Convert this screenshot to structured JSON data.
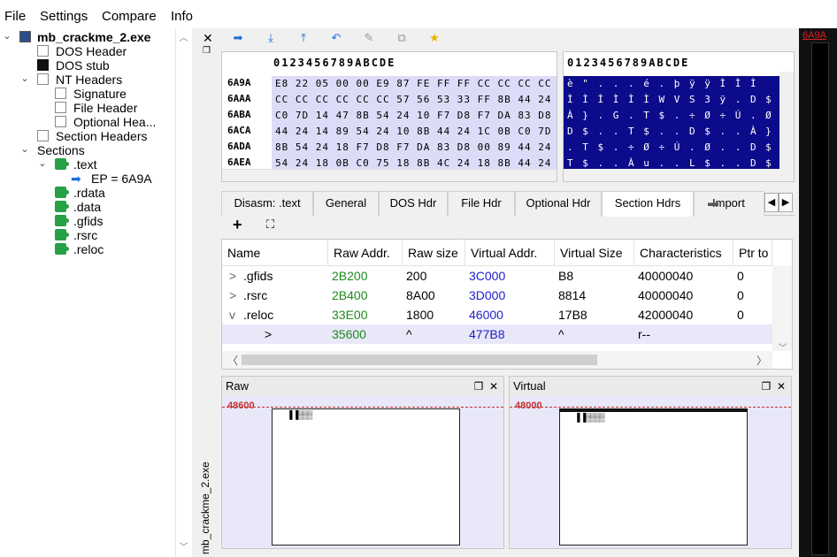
{
  "menu": [
    "File",
    "Settings",
    "Compare",
    "Info"
  ],
  "tree": {
    "root": "mb_crackme_2.exe",
    "dos_header": "DOS Header",
    "dos_stub": "DOS stub",
    "nt_headers": "NT Headers",
    "signature": "Signature",
    "file_header": "File Header",
    "optional_header": "Optional Hea...",
    "section_headers": "Section Headers",
    "sections": "Sections",
    "text": ".text",
    "ep": "EP = 6A9A",
    "rdata": ".rdata",
    "data": ".data",
    "gfids": ".gfids",
    "rsrc": ".rsrc",
    "reloc": ".reloc"
  },
  "side_strip": {
    "label": "mb_crackme_2.exe"
  },
  "hex": {
    "columns": "0123456789ABCDE",
    "rows": [
      {
        "addr": "6A9A",
        "bytes": "E8 22 05 00 00 E9 87 FE FF FF CC CC CC CC CC"
      },
      {
        "addr": "6AAA",
        "bytes": "CC CC CC CC CC CC 57 56 53 33 FF 8B 44 24 14"
      },
      {
        "addr": "6ABA",
        "bytes": "C0 7D 14 47 8B 54 24 10 F7 D8 F7 DA 83 D8 00"
      },
      {
        "addr": "6ACA",
        "bytes": "44 24 14 89 54 24 10 8B 44 24 1C 0B C0 7D 14"
      },
      {
        "addr": "6ADA",
        "bytes": "8B 54 24 18 F7 D8 F7 DA 83 D8 00 89 44 24 10"
      },
      {
        "addr": "6AEA",
        "bytes": "54 24 18 0B C0 75 18 8B 4C 24 18 8B 44 24 10"
      }
    ]
  },
  "text_view": {
    "columns": "0123456789ABCDE",
    "rows": [
      "è \" . . . é . þ ÿ ÿ Ì Ì Ì",
      "Ì Ì Ì Ì Ì Ì W V S 3 ÿ . D $",
      "À } . G . T $ . ÷ Ø ÷ Ú . Ø",
      "D $ . . T $ . . D $ . . À }",
      ". T $ . ÷ Ø ÷ Ú . Ø . . D $",
      "T $ . . À u . . L $ . . D $"
    ]
  },
  "tabs": [
    "Disasm: .text",
    "General",
    "DOS Hdr",
    "File Hdr",
    "Optional Hdr",
    "Section Hdrs",
    "Import"
  ],
  "active_tab": "Section Hdrs",
  "table": {
    "headers": [
      "Name",
      "Raw Addr.",
      "Raw size",
      "Virtual Addr.",
      "Virtual Size",
      "Characteristics",
      "Ptr to"
    ],
    "rows": [
      {
        "exp": ">",
        "name": ".gfids",
        "raw_addr": "2B200",
        "raw_size": "200",
        "virt_addr": "3C000",
        "virt_size": "B8",
        "chars": "40000040",
        "ptr": "0"
      },
      {
        "exp": ">",
        "name": ".rsrc",
        "raw_addr": "2B400",
        "raw_size": "8A00",
        "virt_addr": "3D000",
        "virt_size": "8814",
        "chars": "40000040",
        "ptr": "0"
      },
      {
        "exp": "v",
        "name": ".reloc",
        "raw_addr": "33E00",
        "raw_size": "1800",
        "virt_addr": "46000",
        "virt_size": "17B8",
        "chars": "42000040",
        "ptr": "0"
      },
      {
        "exp": "",
        "name": ">",
        "raw_addr": "35600",
        "raw_size": "^",
        "virt_addr": "477B8",
        "virt_size": "^",
        "chars": "r--",
        "ptr": ""
      }
    ]
  },
  "raw_pane": {
    "title": "Raw",
    "marker": "48600"
  },
  "virtual_pane": {
    "title": "Virtual",
    "marker": "48000"
  },
  "rail": {
    "value": "6A9A"
  },
  "colors": {
    "highlight": "#0b0b8c",
    "hex_bg": "#dcdcf8",
    "green": "#1e8a1e",
    "blue": "#1e1ec8"
  }
}
